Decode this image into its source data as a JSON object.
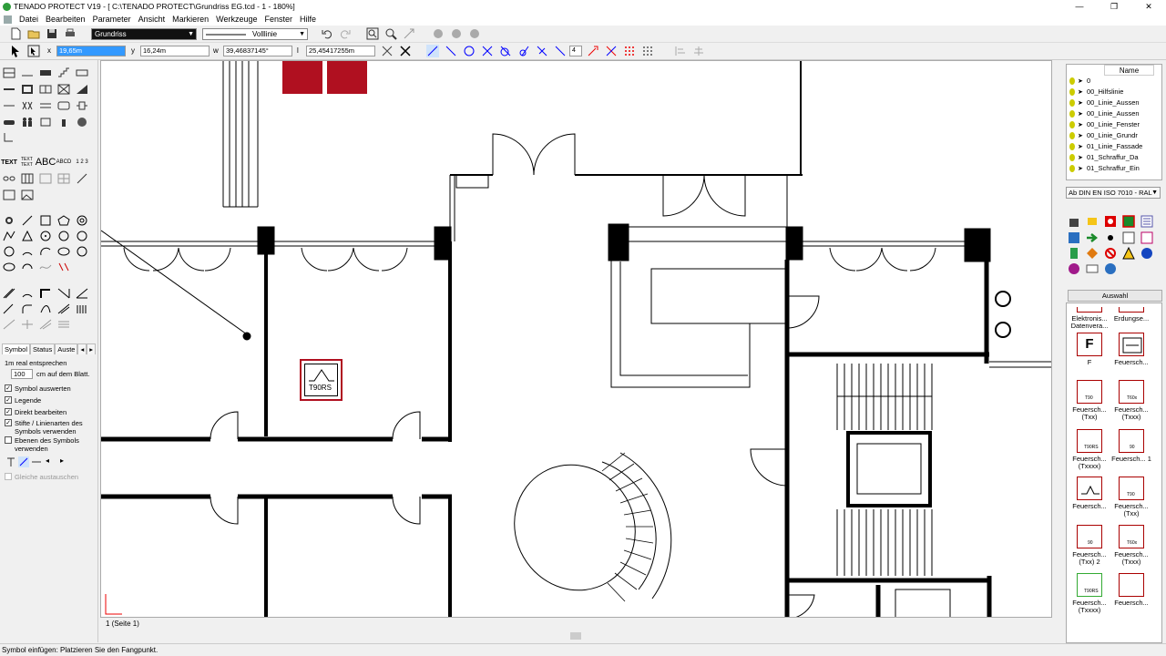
{
  "window": {
    "title": "TENADO PROTECT V19 - [ C:\\TENADO PROTECT\\Grundriss EG.tcd - 1 - 180%]",
    "minimize": "—",
    "restore": "❐",
    "close": "✕"
  },
  "menu": [
    "Datei",
    "Bearbeiten",
    "Parameter",
    "Ansicht",
    "Markieren",
    "Werkzeuge",
    "Fenster",
    "Hilfe"
  ],
  "toolbar": {
    "layer_combo": "Grundriss",
    "line_combo": "Volllinie",
    "x_label": "x",
    "x_value": "19,65m",
    "y_label": "y",
    "y_value": "16,24m",
    "w_label": "w",
    "w_value": "39,46837145°",
    "l_label": "l",
    "l_value": "25,45417255m",
    "step_value": "4"
  },
  "left_tools": {
    "text_label1": "TEXT",
    "text_label2": "TEXT TEXT",
    "abc_label": "ABC",
    "abcd_label": "ABCD",
    "num_label": "1 2 3"
  },
  "left_panel": {
    "tabs": [
      "Symbol",
      "Status",
      "Auste"
    ],
    "scale_text": "1m real entsprechen",
    "scale_value": "100",
    "scale_unit": "cm auf dem Blatt.",
    "checks": [
      {
        "label": "Symbol auswerten",
        "checked": true
      },
      {
        "label": "Legende",
        "checked": true
      },
      {
        "label": "Direkt bearbeiten",
        "checked": true
      },
      {
        "label": "Stifte / Linienarten des Symbols verwenden",
        "checked": true
      },
      {
        "label": "Ebenen des Symbols verwenden",
        "checked": false
      }
    ],
    "replace_label": "Gleiche austauschen"
  },
  "canvas": {
    "placed_symbol_label": "T90RS"
  },
  "page_label": "1 (Seite 1)",
  "status_text": "Symbol einfügen: Platzieren Sie den Fangpunkt.",
  "right_panel": {
    "layer_header": "Name",
    "layers": [
      "0",
      "00_Hilfslinie",
      "00_Linie_Aussen",
      "00_Linie_Aussen",
      "00_Linie_Fenster",
      "00_Linie_Grundr",
      "01_Linie_Fassade",
      "01_Schraffur_Da",
      "01_Schraffur_Ein"
    ],
    "symbol_set": "Ab DIN EN ISO 7010 - RAL",
    "select_button": "Auswahl",
    "symbols": [
      {
        "label": "Elektronis... Datenvera...",
        "glyph": ""
      },
      {
        "label": "Erdungse...",
        "glyph": ""
      },
      {
        "label": "F",
        "glyph": "F"
      },
      {
        "label": "Feuersch...",
        "glyph": ""
      },
      {
        "label": "Feuersch... (Txx)",
        "glyph": "T90"
      },
      {
        "label": "Feuersch... (Txxx)",
        "glyph": "T60x"
      },
      {
        "label": "Feuersch... (Txxxx)",
        "glyph": "T90RS"
      },
      {
        "label": "Feuersch... 1",
        "glyph": "90"
      },
      {
        "label": "Feuersch...",
        "glyph": ""
      },
      {
        "label": "Feuersch... (Txx)",
        "glyph": "T90"
      },
      {
        "label": "Feuersch... (Txx) 2",
        "glyph": "90"
      },
      {
        "label": "Feuersch... (Txxx)",
        "glyph": "T60x"
      },
      {
        "label": "Feuersch... (Txxxx)",
        "glyph": "T90RS"
      },
      {
        "label": "Feuersch...",
        "glyph": ""
      }
    ]
  },
  "colors": {
    "accent": "#b01020",
    "ui_bg": "#f0f0f0",
    "select_highlight": "#3399ff"
  }
}
